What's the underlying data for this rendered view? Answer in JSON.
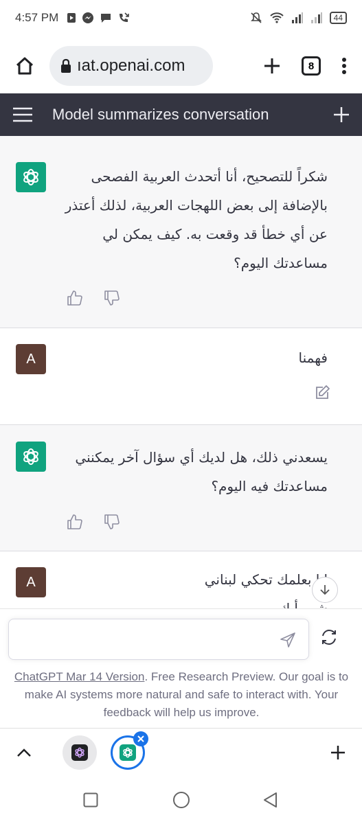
{
  "status_bar": {
    "time": "4:57 PM",
    "battery": "44"
  },
  "browser": {
    "url": "ıat.openai.com",
    "tab_count": "8"
  },
  "app_bar": {
    "title": "Model summarizes conversation"
  },
  "messages": [
    {
      "role": "assistant",
      "lines": [
        "شكراً للتصحيح، أنا أتحدث العربية الفصحى",
        "بالإضافة إلى بعض اللهجات العربية، لذلك أعتذر",
        "عن أي خطأ قد وقعت به. كيف يمكن لي",
        "مساعدتك اليوم؟"
      ]
    },
    {
      "role": "user",
      "avatar_letter": "A",
      "lines": [
        "فهمنا"
      ]
    },
    {
      "role": "assistant",
      "lines": [
        "يسعدني ذلك، هل لديك أي سؤال آخر يمكنني",
        "مساعدتك فيه اليوم؟"
      ]
    },
    {
      "role": "user",
      "avatar_letter": "A",
      "lines": [
        "انا بعلمك تحكي لبناني",
        "شو رأيك"
      ]
    }
  ],
  "composer": {
    "placeholder": ""
  },
  "disclaimer": {
    "link": "ChatGPT Mar 14 Version",
    "text": ". Free Research Preview. Our goal is to make AI systems more natural and safe to interact with. Your feedback will help us improve."
  },
  "icons": {
    "home": "home-icon",
    "lock": "lock-icon",
    "new_tab": "plus-icon",
    "menu": "more-vert-icon",
    "hamburger": "hamburger-icon",
    "new_chat": "plus-icon",
    "bot": "openai-logo-icon",
    "thumbs_up": "thumbs-up-icon",
    "thumbs_down": "thumbs-down-icon",
    "edit": "edit-icon",
    "scroll_down": "arrow-down-icon",
    "send": "send-icon",
    "regenerate": "refresh-icon"
  },
  "colors": {
    "app_bar": "#343541",
    "assistant_bg": "#f7f7f8",
    "bot_avatar": "#10a37f",
    "user_avatar": "#5d3d34",
    "active_tab_ring": "#1a73e8"
  }
}
